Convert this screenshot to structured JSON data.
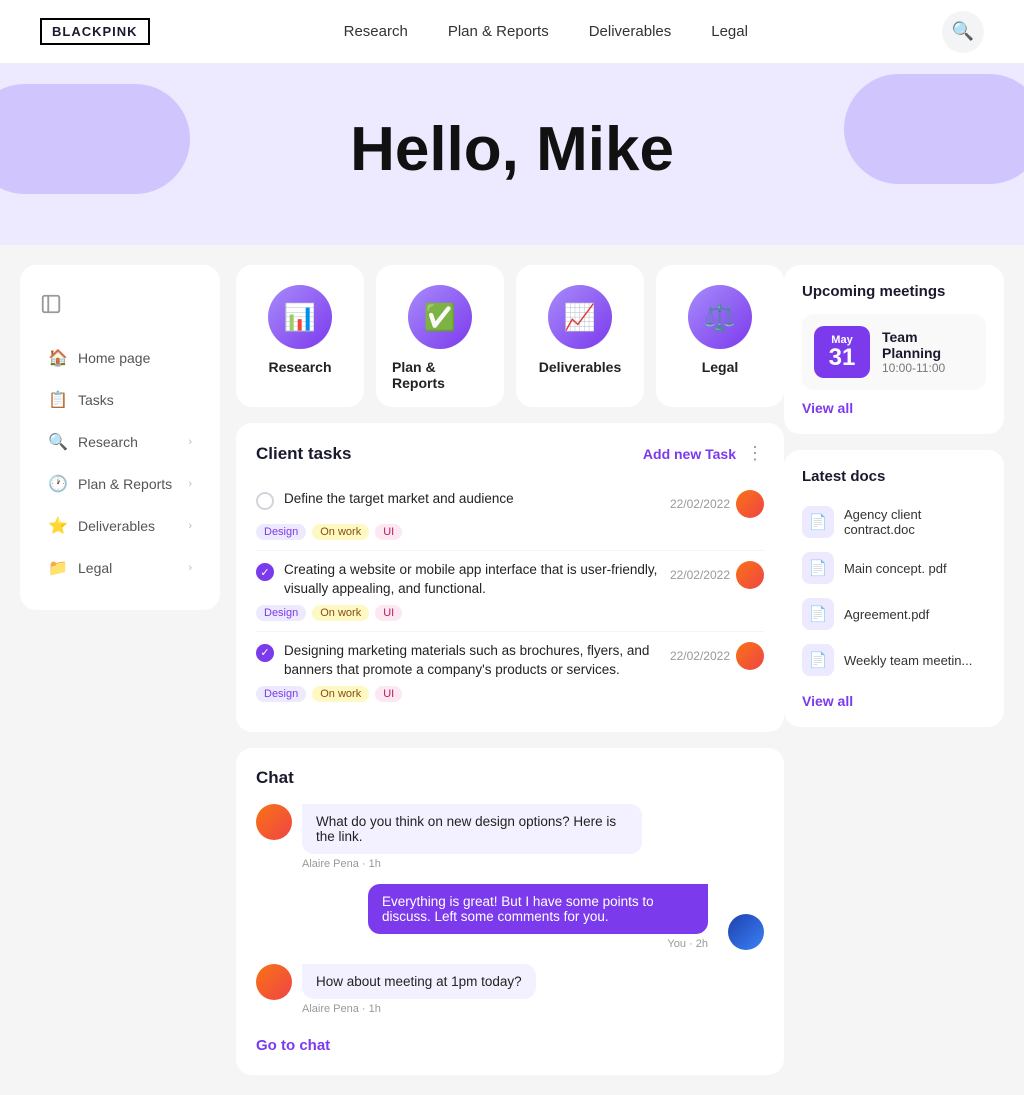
{
  "logo": "BLACKPINK",
  "nav": {
    "links": [
      "Research",
      "Plan & Reports",
      "Deliverables",
      "Legal"
    ]
  },
  "hero": {
    "greeting": "Hello, Mike"
  },
  "sidebar": {
    "items": [
      {
        "id": "home-page",
        "icon": "🏠",
        "label": "Home page",
        "hasArrow": false
      },
      {
        "id": "tasks",
        "icon": "📋",
        "label": "Tasks",
        "hasArrow": false
      },
      {
        "id": "research",
        "icon": "🔍",
        "label": "Research",
        "hasArrow": true
      },
      {
        "id": "plan-reports",
        "icon": "🕐",
        "label": "Plan & Reports",
        "hasArrow": true
      },
      {
        "id": "deliverables",
        "icon": "⭐",
        "label": "Deliverables",
        "hasArrow": true
      },
      {
        "id": "legal",
        "icon": "📁",
        "label": "Legal",
        "hasArrow": true
      }
    ]
  },
  "categories": [
    {
      "id": "research",
      "label": "Research",
      "icon": "📊"
    },
    {
      "id": "plan-reports",
      "label": "Plan & Reports",
      "icon": "✅"
    },
    {
      "id": "deliverables",
      "label": "Deliverables",
      "icon": "📈"
    },
    {
      "id": "legal",
      "label": "Legal",
      "icon": "⚖️"
    }
  ],
  "client_tasks": {
    "title": "Client tasks",
    "add_label": "Add new Task",
    "tasks": [
      {
        "text": "Define the target market and audience",
        "done": false,
        "date": "22/02/2022",
        "tags": [
          "Design",
          "On work",
          "UI"
        ]
      },
      {
        "text": "Creating a website or mobile app interface that is user-friendly, visually appealing, and functional.",
        "done": true,
        "date": "22/02/2022",
        "tags": [
          "Design",
          "On work",
          "UI"
        ]
      },
      {
        "text": "Designing marketing materials such as brochures, flyers, and banners that promote a company's products or services.",
        "done": true,
        "date": "22/02/2022",
        "tags": [
          "Design",
          "On work",
          "UI"
        ]
      }
    ]
  },
  "chat": {
    "title": "Chat",
    "messages": [
      {
        "id": "msg1",
        "side": "left",
        "sender": "Alaire Pena",
        "time": "1h",
        "text": "What do you think on new design options? Here is the link."
      },
      {
        "id": "msg2",
        "side": "right",
        "sender": "You",
        "time": "2h",
        "text": "Everything is great! But I have some points to discuss. Left some comments for you."
      },
      {
        "id": "msg3",
        "side": "left",
        "sender": "Alaire Pena",
        "time": "1h",
        "text": "How about meeting at 1pm today?"
      }
    ],
    "go_to_chat": "Go to chat"
  },
  "meetings": {
    "title": "Upcoming meetings",
    "meeting": {
      "month": "May",
      "day": "31",
      "name": "Team Planning",
      "time": "10:00-11:00"
    },
    "view_all": "View all"
  },
  "docs": {
    "title": "Latest docs",
    "items": [
      {
        "name": "Agency client contract.doc",
        "icon": "📄"
      },
      {
        "name": "Main concept. pdf",
        "icon": "📄"
      },
      {
        "name": "Agreement.pdf",
        "icon": "📄"
      },
      {
        "name": "Weekly team meetin...",
        "icon": "📄"
      }
    ],
    "view_all": "View all"
  }
}
